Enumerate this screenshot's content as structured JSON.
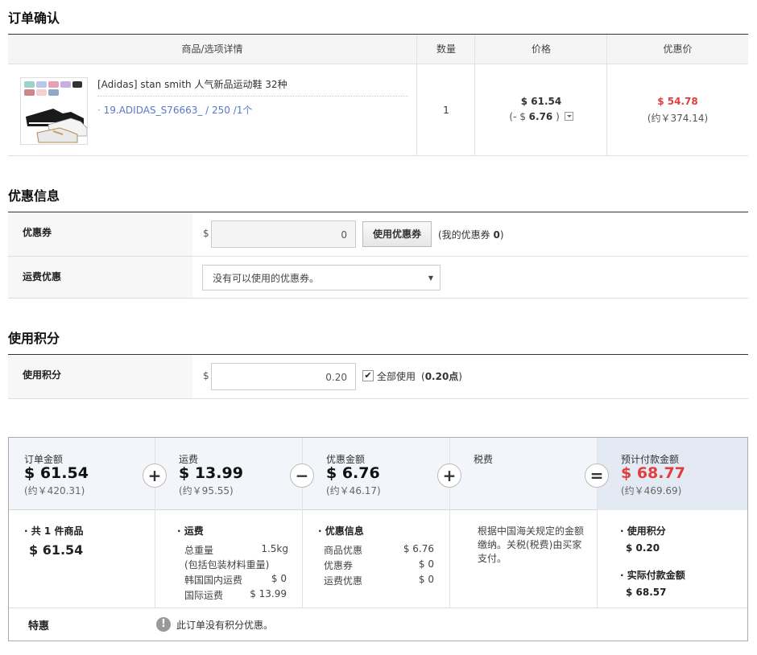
{
  "order": {
    "title": "订单确认",
    "headers": [
      "商品/选项详情",
      "数量",
      "价格",
      "优惠价"
    ],
    "item": {
      "name": "[Adidas] stan smith 人气新品运动鞋 32种",
      "option": "19.ADIDAS_S76663_ / 250 /1个",
      "quantity": "1",
      "price": "$ 61.54",
      "discount_prefix": "(- $ ",
      "discount_value": "6.76",
      "discount_suffix": " )",
      "sale_price": "$ 54.78",
      "sale_price_krw": "(约￥374.14)"
    }
  },
  "discount": {
    "title": "优惠信息",
    "coupon_label": "优惠券",
    "currency": "$",
    "coupon_value": "0",
    "coupon_button": "使用优惠券",
    "my_coupons_prefix": "(我的优惠券 ",
    "my_coupons_count": "0",
    "my_coupons_suffix": ")",
    "shipping_label": "运费优惠",
    "shipping_select": "没有可以使用的优惠券。"
  },
  "points": {
    "title": "使用积分",
    "label": "使用积分",
    "currency": "$",
    "value": "0.20",
    "use_all_label": "全部使用",
    "available_prefix": "(",
    "available_value": "0.20点",
    "available_suffix": ")"
  },
  "summary": {
    "order_total": {
      "label": "订单金额",
      "amount": "$ 61.54",
      "cny": "(约￥420.31)"
    },
    "shipping": {
      "label": "运费",
      "amount": "$ 13.99",
      "cny": "(约￥95.55)"
    },
    "discount_total": {
      "label": "优惠金额",
      "amount": "$ 6.76",
      "cny": "(约￥46.17)"
    },
    "tax": {
      "label": "税费"
    },
    "estimated": {
      "label": "预计付款金额",
      "amount": "$ 68.77",
      "cny": "(约￥469.69)"
    },
    "ops": [
      "+",
      "+",
      "−",
      "+",
      "="
    ],
    "details": {
      "items_head_a": "· 共 ",
      "items_count": "1",
      "items_head_b": " 件商品",
      "items_amount": "$ 61.54",
      "shipping_head": "· 运费",
      "weight_label": "总重量",
      "weight_value": "1.5kg",
      "weight_note": "(包括包装材料重量)",
      "korea_ship_label": "韩国国内运费",
      "korea_ship_value": "$ 0",
      "intl_ship_label": "国际运费",
      "intl_ship_value": "$ 13.99",
      "discount_head": "· 优惠信息",
      "prod_disc_label": "商品优惠",
      "prod_disc_value": "$ 6.76",
      "coupon_label": "优惠券",
      "coupon_value": "$ 0",
      "ship_disc_label": "运费优惠",
      "ship_disc_value": "$ 0",
      "tax_note": "根据中国海关规定的金额缴纳。关税(税费)由买家支付。",
      "points_head": "· 使用积分",
      "points_value": "$ 0.20",
      "actual_head": "· 实际付款金额",
      "actual_value": "$ 68.57"
    },
    "special": {
      "label": "特惠",
      "icon": "!",
      "text": "此订单没有积分优惠。"
    }
  },
  "colors": {
    "accent_red": "#e03e3e",
    "link_blue": "#5a78c8"
  }
}
